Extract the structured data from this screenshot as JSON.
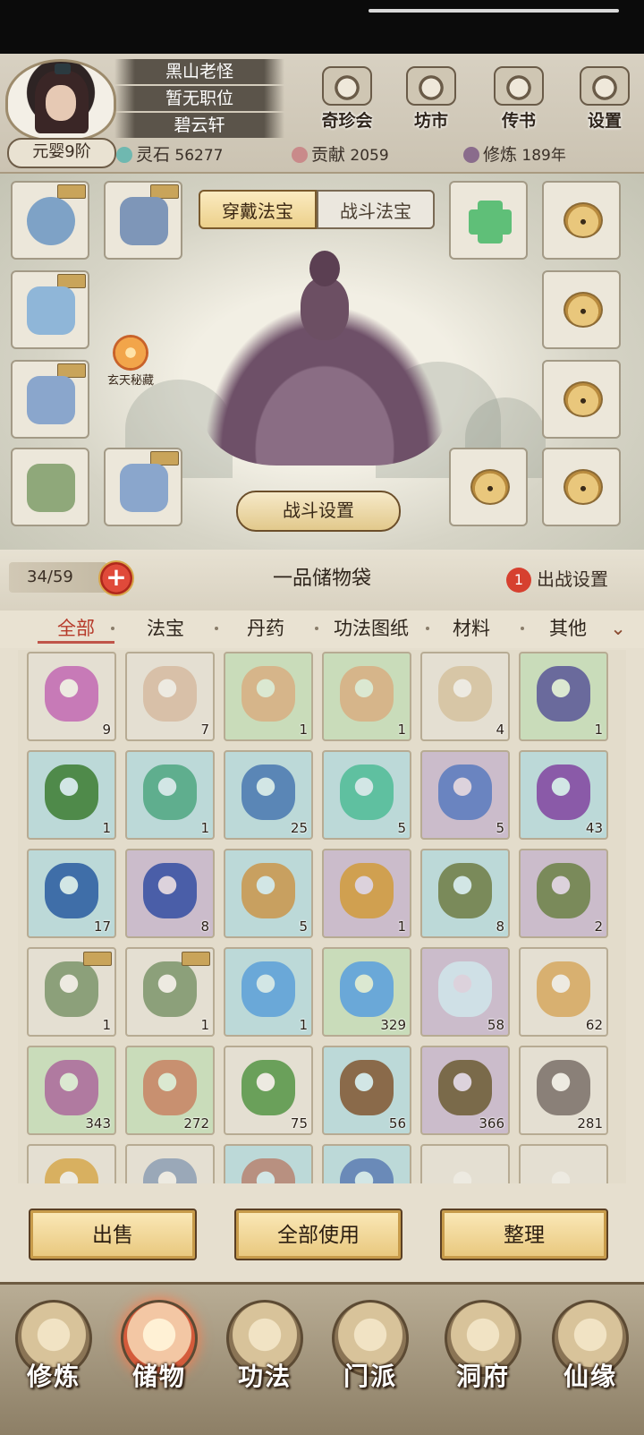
{
  "player": {
    "name": "黑山老怪",
    "position": "暂无职位",
    "sect_house": "碧云轩",
    "realm": "元婴9阶"
  },
  "resources": [
    {
      "label": "灵石",
      "value": "56277",
      "color": "#6fb8b0"
    },
    {
      "label": "贡献",
      "value": "2059",
      "color": "#c98a8a"
    },
    {
      "label": "修炼",
      "value": "189年",
      "color": "#8a6c8c"
    }
  ],
  "top_buttons": [
    {
      "label": "奇珍会",
      "icon": "treasure-hall-icon"
    },
    {
      "label": "坊市",
      "icon": "market-icon"
    },
    {
      "label": "传书",
      "icon": "scroll-mail-icon"
    },
    {
      "label": "设置",
      "icon": "gear-icon"
    }
  ],
  "equip_tabs": {
    "active": "穿戴法宝",
    "inactive": "战斗法宝"
  },
  "xuantian_label": "玄天秘藏",
  "battle_settings": "战斗设置",
  "bag": {
    "capacity": "34/59",
    "title": "一品储物袋",
    "deploy_count": "1",
    "deploy_label": "出战设置"
  },
  "categories": [
    "全部",
    "法宝",
    "丹药",
    "功法图纸",
    "材料",
    "其他"
  ],
  "items": [
    {
      "count": "9",
      "bg": "#e4dfd2",
      "art": "#c77ab7",
      "tag": false
    },
    {
      "count": "7",
      "bg": "#e4dfd2",
      "art": "#d8c0a8",
      "tag": false
    },
    {
      "count": "1",
      "bg": "#c9dcba",
      "art": "#d6b58a",
      "tag": false
    },
    {
      "count": "1",
      "bg": "#c9dcba",
      "art": "#d6b58a",
      "tag": false
    },
    {
      "count": "4",
      "bg": "#e4dfd2",
      "art": "#d7c6a6",
      "tag": false
    },
    {
      "count": "1",
      "bg": "#c9dcba",
      "art": "#6a6a9c",
      "tag": false
    },
    {
      "count": "1",
      "bg": "#bcd9d8",
      "art": "#4f8a4a",
      "tag": false
    },
    {
      "count": "1",
      "bg": "#bcd9d8",
      "art": "#5fae8e",
      "tag": false
    },
    {
      "count": "25",
      "bg": "#bcd9d8",
      "art": "#5a86b6",
      "tag": false
    },
    {
      "count": "5",
      "bg": "#bcd9d8",
      "art": "#5fc0a0",
      "tag": false
    },
    {
      "count": "5",
      "bg": "#cbbccb",
      "art": "#6a84c0",
      "tag": false
    },
    {
      "count": "43",
      "bg": "#bcd9d8",
      "art": "#8a5aa8",
      "tag": false
    },
    {
      "count": "17",
      "bg": "#bcd9d8",
      "art": "#3f6ea8",
      "tag": false
    },
    {
      "count": "8",
      "bg": "#cbbccb",
      "art": "#4a5ea8",
      "tag": false
    },
    {
      "count": "5",
      "bg": "#bcd9d8",
      "art": "#c8a060",
      "tag": false
    },
    {
      "count": "1",
      "bg": "#cbbccb",
      "art": "#d0a050",
      "tag": false
    },
    {
      "count": "8",
      "bg": "#bcd9d8",
      "art": "#7a8a5a",
      "tag": false
    },
    {
      "count": "2",
      "bg": "#cbbccb",
      "art": "#7a8a5a",
      "tag": false
    },
    {
      "count": "1",
      "bg": "#e4dfd2",
      "art": "#8ca07a",
      "tag": true
    },
    {
      "count": "1",
      "bg": "#e4dfd2",
      "art": "#8ca07a",
      "tag": true
    },
    {
      "count": "1",
      "bg": "#bcd9d8",
      "art": "#6aa8d8",
      "tag": false
    },
    {
      "count": "329",
      "bg": "#c9dcba",
      "art": "#6aa8d8",
      "tag": false
    },
    {
      "count": "58",
      "bg": "#cbbccb",
      "art": "#cfe0e6",
      "tag": false
    },
    {
      "count": "62",
      "bg": "#e4dfd2",
      "art": "#d8b070",
      "tag": false
    },
    {
      "count": "343",
      "bg": "#c9dcba",
      "art": "#b07aa0",
      "tag": false
    },
    {
      "count": "272",
      "bg": "#c9dcba",
      "art": "#c89070",
      "tag": false
    },
    {
      "count": "75",
      "bg": "#e4dfd2",
      "art": "#6aa05a",
      "tag": false
    },
    {
      "count": "56",
      "bg": "#bcd9d8",
      "art": "#8a6a4a",
      "tag": false
    },
    {
      "count": "366",
      "bg": "#cbbccb",
      "art": "#7a6a4a",
      "tag": false
    },
    {
      "count": "281",
      "bg": "#e4dfd2",
      "art": "#8a8078",
      "tag": false
    },
    {
      "count": "",
      "bg": "#e4dfd2",
      "art": "#d8b060",
      "tag": false
    },
    {
      "count": "",
      "bg": "#e4dfd2",
      "art": "#9aa8b8",
      "tag": false
    },
    {
      "count": "",
      "bg": "#bcd9d8",
      "art": "#b89080",
      "tag": false
    },
    {
      "count": "",
      "bg": "#bcd9d8",
      "art": "#6a8ab8",
      "tag": false
    },
    {
      "count": "",
      "bg": "#e4dfd2",
      "art": "#e4dfd2",
      "tag": false
    },
    {
      "count": "",
      "bg": "#e4dfd2",
      "art": "#e4dfd2",
      "tag": false
    }
  ],
  "actions": [
    "出售",
    "全部使用",
    "整理"
  ],
  "nav": [
    {
      "label": "修炼",
      "icon": "cultivation-icon",
      "active": false
    },
    {
      "label": "储物",
      "icon": "storage-bag-icon",
      "active": true
    },
    {
      "label": "功法",
      "icon": "skill-scroll-icon",
      "active": false
    },
    {
      "label": "门派",
      "icon": "sect-gate-icon",
      "active": false
    },
    {
      "label": "洞府",
      "icon": "cave-mountain-icon",
      "active": false
    },
    {
      "label": "仙缘",
      "icon": "taiji-icon",
      "active": false
    }
  ]
}
